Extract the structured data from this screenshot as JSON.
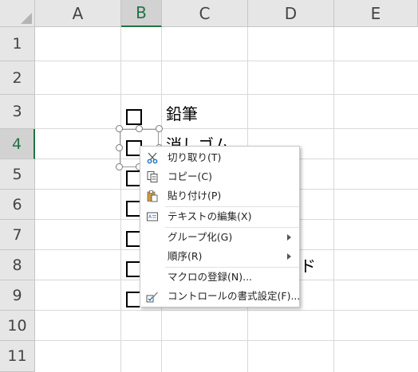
{
  "grid": {
    "columns": [
      "A",
      "B",
      "C",
      "D",
      "E"
    ],
    "rows": [
      "1",
      "2",
      "3",
      "4",
      "5",
      "6",
      "7",
      "8",
      "9",
      "10",
      "11"
    ]
  },
  "cells": {
    "c3_text": "鉛筆",
    "c4_text": "消しゴム",
    "d8_text": "ード"
  },
  "context_menu": {
    "items": [
      {
        "label": "切り取り(T)",
        "icon": "scissors-icon"
      },
      {
        "label": "コピー(C)",
        "icon": "copy-icon"
      },
      {
        "label": "貼り付け(P)",
        "icon": "paste-icon"
      },
      {
        "label": "テキストの編集(X)",
        "icon": "edit-text-icon"
      },
      {
        "label": "グループ化(G)",
        "has_submenu": true
      },
      {
        "label": "順序(R)",
        "has_submenu": true
      },
      {
        "label": "マクロの登録(N)..."
      },
      {
        "label": "コントロールの書式設定(F)...",
        "icon": "format-control-icon"
      }
    ]
  },
  "colors": {
    "accent": "#217346",
    "header_bg": "#e6e6e6",
    "gridline": "#d9d9d9"
  }
}
